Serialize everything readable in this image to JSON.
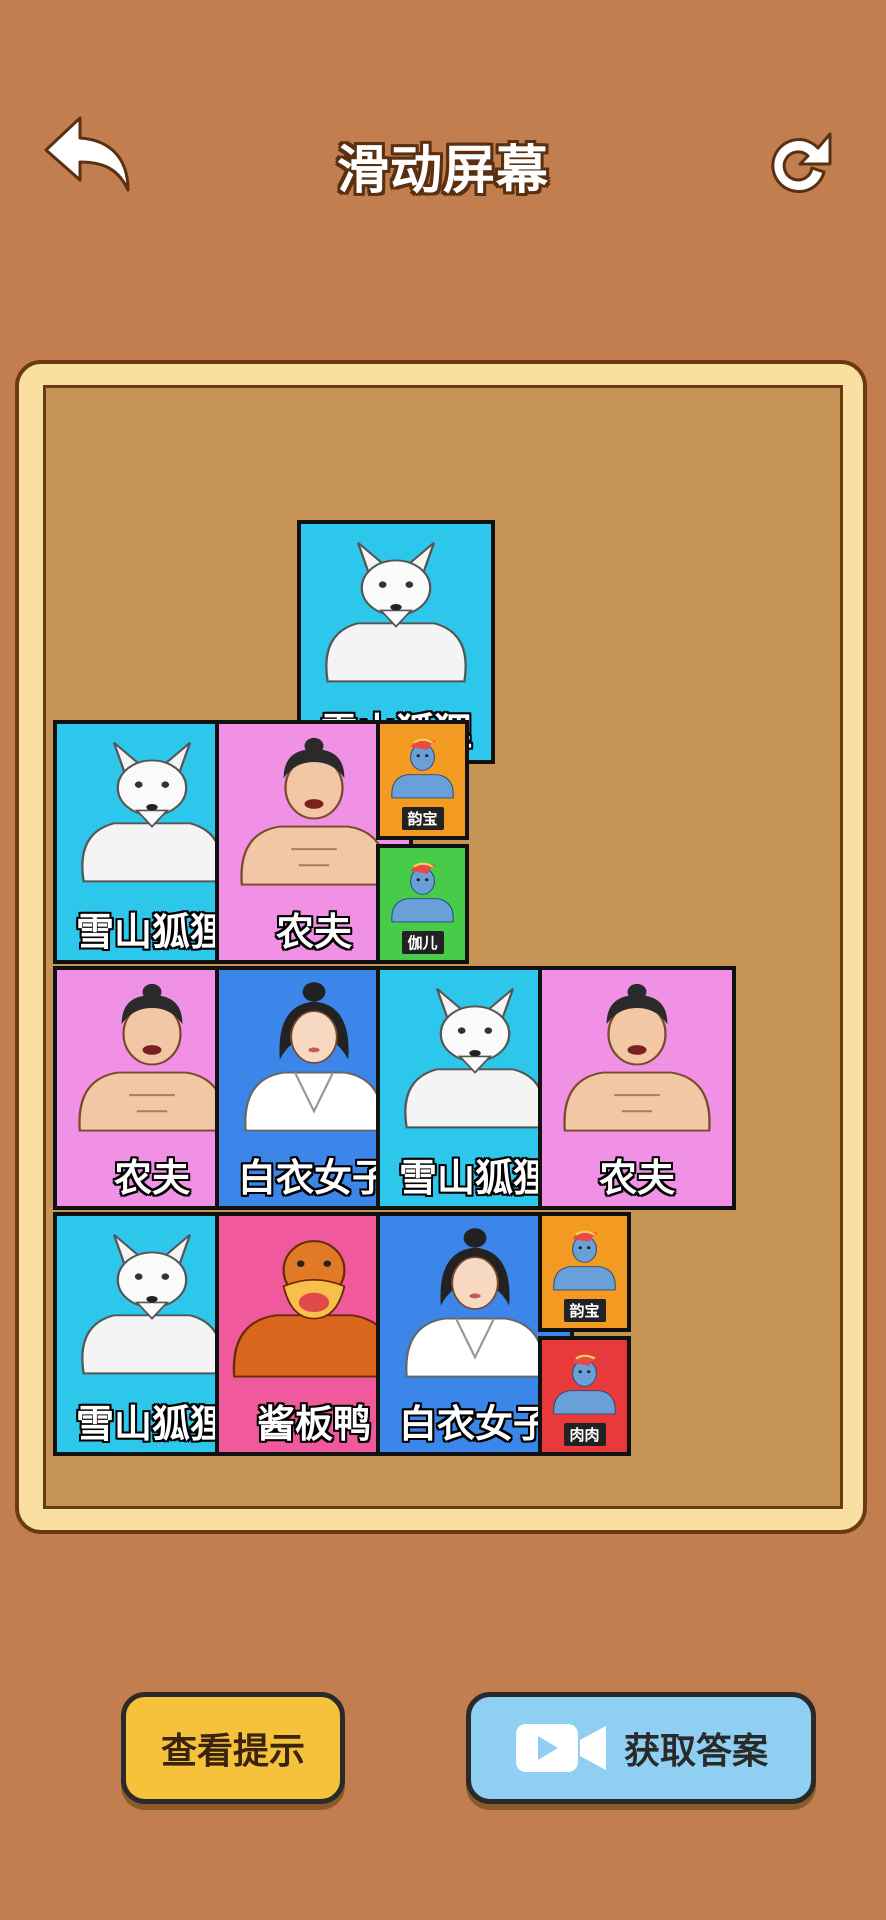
{
  "header": {
    "title": "滑动屏幕",
    "back_icon": "back-arrow-icon",
    "refresh_icon": "refresh-icon"
  },
  "board": {
    "colors": {
      "cyan": "#2ec7ec",
      "pink": "#f191e6",
      "blue": "#3b86e8",
      "hotpink": "#f05a9c",
      "orange": "#f29a22",
      "green": "#46cc48",
      "red": "#e83a3a"
    },
    "tiles": [
      {
        "label": "雪山狐狸",
        "character": "fox"
      },
      {
        "label": "雪山狐狸",
        "character": "fox"
      },
      {
        "label": "农夫",
        "character": "farmer"
      },
      {
        "label": "韵宝",
        "character": "pony"
      },
      {
        "label": "伽儿",
        "character": "pony"
      },
      {
        "label": "农夫",
        "character": "farmer"
      },
      {
        "label": "白衣女子",
        "character": "woman"
      },
      {
        "label": "雪山狐狸",
        "character": "fox"
      },
      {
        "label": "农夫",
        "character": "farmer"
      },
      {
        "label": "雪山狐狸",
        "character": "fox"
      },
      {
        "label": "酱板鸭",
        "character": "duck"
      },
      {
        "label": "白衣女子",
        "character": "woman"
      },
      {
        "label": "韵宝",
        "character": "pony"
      },
      {
        "label": "肉肉",
        "character": "pony"
      }
    ]
  },
  "buttons": {
    "hint_label": "查看提示",
    "answer_label": "获取答案",
    "video_icon": "video-camera-icon"
  }
}
